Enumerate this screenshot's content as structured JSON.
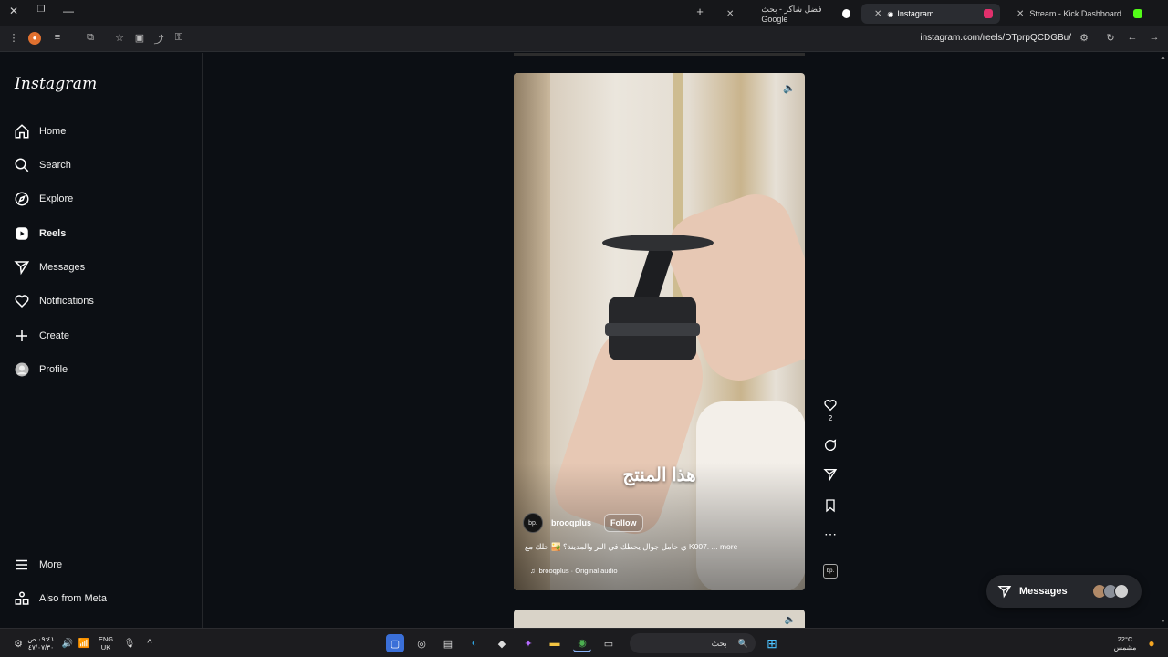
{
  "browser": {
    "tabs": [
      {
        "label": "Stream - Kick Dashboard",
        "active": false,
        "favicon_color": "#53fc18"
      },
      {
        "label": "Instagram",
        "active": true,
        "favicon_color": "#e1306c"
      },
      {
        "label": "فضل شاكر - بحث Google",
        "active": false,
        "favicon_color": "#4285f4"
      }
    ],
    "url": "instagram.com/reels/DTprpQCDGBu/"
  },
  "sidebar": {
    "logo": "Instagram",
    "items": [
      {
        "label": "Home",
        "icon": "home-icon"
      },
      {
        "label": "Search",
        "icon": "search-icon"
      },
      {
        "label": "Explore",
        "icon": "compass-icon"
      },
      {
        "label": "Reels",
        "icon": "reels-icon",
        "active": true
      },
      {
        "label": "Messages",
        "icon": "send-icon"
      },
      {
        "label": "Notifications",
        "icon": "heart-icon"
      },
      {
        "label": "Create",
        "icon": "plus-icon"
      },
      {
        "label": "Profile",
        "icon": "profile-icon"
      }
    ],
    "more": "More",
    "also_from_meta": "Also from Meta"
  },
  "reel": {
    "overlay_text": "هذا المنتج",
    "author_avatar_text": "bp.",
    "author": "brooqplus",
    "follow_label": "Follow",
    "description": "ي حامل جوال يحطك في البر والمدينة؟ 🏜️ حلك مع K007. ... more",
    "audio": "brooqplus · Original audio",
    "likes": "2"
  },
  "messages_pill": {
    "label": "Messages"
  },
  "taskbar": {
    "lang": "ENG",
    "region": "UK",
    "time": "٠٩:٤١ ص",
    "date": "٤٧/٠٧/٣٠",
    "search_placeholder": "بحث",
    "weather_temp": "22°C",
    "weather_desc": "مشمس"
  }
}
